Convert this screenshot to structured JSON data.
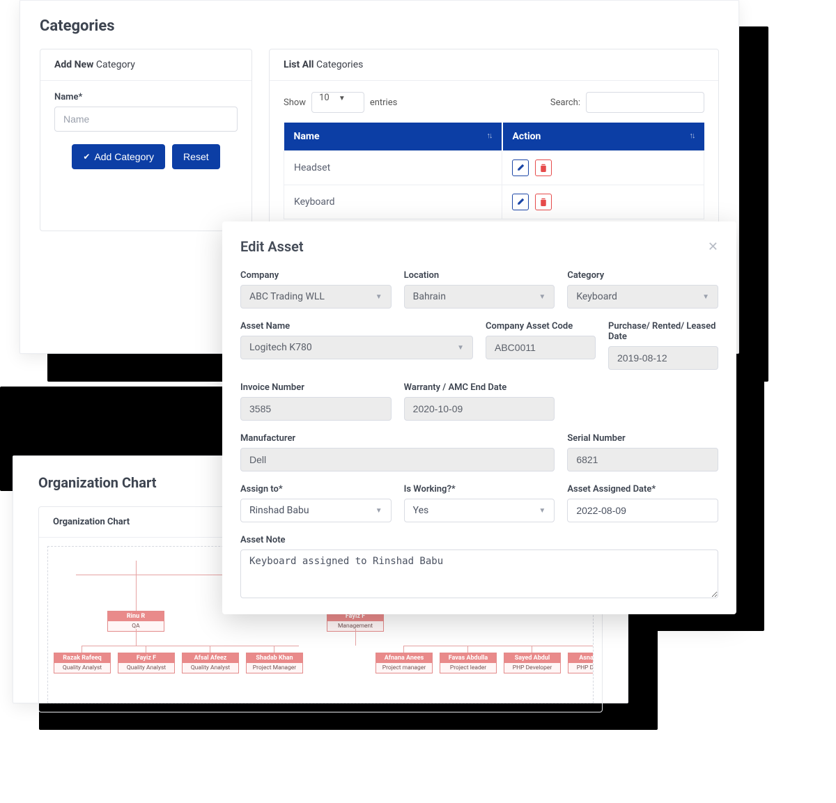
{
  "categories": {
    "page_title": "Categories",
    "add_card": {
      "header_bold": "Add New",
      "header_rest": " Category",
      "name_label": "Name*",
      "name_placeholder": "Name",
      "add_button": "Add Category",
      "reset_button": "Reset"
    },
    "list_card": {
      "header_bold": "List All",
      "header_rest": " Categories",
      "show_label": "Show",
      "entries_value": "10",
      "entries_label": "entries",
      "search_label": "Search:",
      "columns": {
        "name": "Name",
        "action": "Action"
      },
      "rows": [
        {
          "name": "Headset"
        },
        {
          "name": "Keyboard"
        }
      ]
    }
  },
  "org": {
    "title": "Organization Chart",
    "sub_header": "Organization Chart",
    "roots": [
      {
        "name": "Rinu R",
        "role": "QA"
      },
      {
        "name": "Fayiz F",
        "role": "Management"
      }
    ],
    "left_children": [
      {
        "name": "Razak Rafeeq",
        "role": "Quality Analyst"
      },
      {
        "name": "Fayiz F",
        "role": "Quality Analyst"
      },
      {
        "name": "Afsal Afeez",
        "role": "Quality Analyst"
      },
      {
        "name": "Shadab Khan",
        "role": "Project Manager"
      }
    ],
    "right_children": [
      {
        "name": "Afnana Anees",
        "role": "Project manager"
      },
      {
        "name": "Favas Abdulla",
        "role": "Project leader"
      },
      {
        "name": "Sayed Abdul",
        "role": "PHP Developer"
      },
      {
        "name": "Asna Ameer",
        "role": "PHP Developer"
      }
    ]
  },
  "edit_asset": {
    "title": "Edit Asset",
    "fields": {
      "company": {
        "label": "Company",
        "value": "ABC Trading WLL"
      },
      "location": {
        "label": "Location",
        "value": "Bahrain"
      },
      "category": {
        "label": "Category",
        "value": "Keyboard"
      },
      "asset_name": {
        "label": "Asset Name",
        "value": "Logitech K780"
      },
      "company_asset_code": {
        "label": "Company Asset Code",
        "value": "ABC0011"
      },
      "purchase_date": {
        "label": "Purchase/ Rented/ Leased Date",
        "value": "2019-08-12"
      },
      "invoice_number": {
        "label": "Invoice Number",
        "value": "3585"
      },
      "warranty_end": {
        "label": "Warranty / AMC End Date",
        "value": "2020-10-09"
      },
      "manufacturer": {
        "label": "Manufacturer",
        "value": "Dell"
      },
      "serial_number": {
        "label": "Serial Number",
        "value": "6821"
      },
      "assign_to": {
        "label": "Assign to*",
        "value": "Rinshad Babu"
      },
      "is_working": {
        "label": "Is Working?*",
        "value": "Yes"
      },
      "assigned_date": {
        "label": "Asset Assigned Date*",
        "value": "2022-08-09"
      },
      "asset_note": {
        "label": "Asset Note",
        "value": "Keyboard assigned to Rinshad Babu"
      }
    }
  }
}
